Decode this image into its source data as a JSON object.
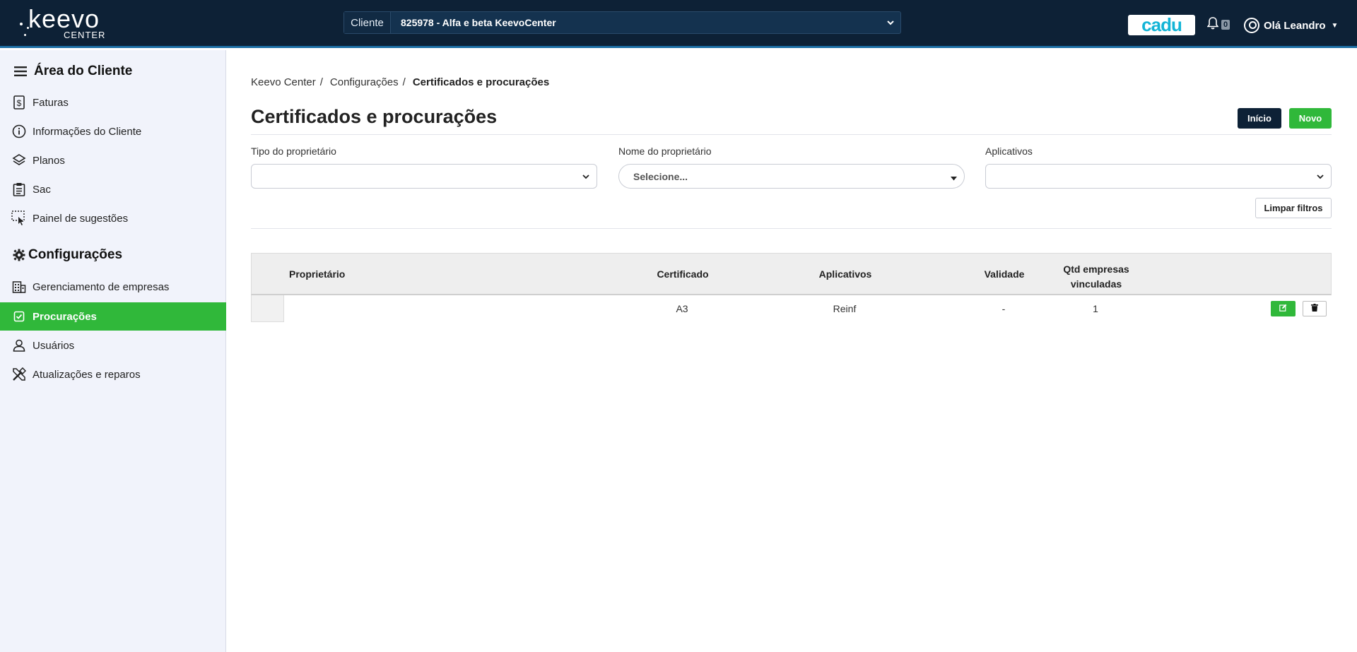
{
  "header": {
    "logo_text": "keevo",
    "logo_sub": "CENTER",
    "client_label": "Cliente",
    "client_value": "825978 - Alfa e beta KeevoCenter",
    "cadu_label": "cadu",
    "notification_count": "0",
    "user_greeting": "Olá Leandro"
  },
  "sidebar": {
    "section1_title": "Área do Cliente",
    "section1_items": [
      {
        "label": "Faturas",
        "icon": "invoice-icon"
      },
      {
        "label": "Informações do Cliente",
        "icon": "info-icon"
      },
      {
        "label": "Planos",
        "icon": "layers-icon"
      },
      {
        "label": "Sac",
        "icon": "clipboard-icon"
      },
      {
        "label": "Painel de sugestões",
        "icon": "pointer-icon"
      }
    ],
    "section2_title": "Configurações",
    "section2_items": [
      {
        "label": "Gerenciamento de empresas",
        "icon": "building-icon"
      },
      {
        "label": "Procurações",
        "icon": "check-square-icon",
        "active": true
      },
      {
        "label": "Usuários",
        "icon": "user-icon"
      },
      {
        "label": "Atualizações e reparos",
        "icon": "tools-icon"
      }
    ]
  },
  "breadcrumb": {
    "items": [
      "Keevo Center",
      "Configurações"
    ],
    "current": "Certificados e procurações"
  },
  "page": {
    "title": "Certificados e procurações",
    "btn_inicio": "Início",
    "btn_novo": "Novo"
  },
  "filters": {
    "tipo_label": "Tipo do proprietário",
    "tipo_value": "",
    "nome_label": "Nome do proprietário",
    "nome_value": "Selecione...",
    "aplicativos_label": "Aplicativos",
    "aplicativos_value": "",
    "limpar_label": "Limpar filtros"
  },
  "table": {
    "headers": {
      "proprietario": "Proprietário",
      "certificado": "Certificado",
      "aplicativos": "Aplicativos",
      "validade": "Validade",
      "qtd_line1": "Qtd empresas",
      "qtd_line2": "vinculadas"
    },
    "rows": [
      {
        "proprietario": "",
        "certificado": "A3",
        "aplicativos": "Reinf",
        "validade": "-",
        "qtd": "1"
      }
    ]
  },
  "colors": {
    "topbar": "#0d2136",
    "accent_green": "#30b83a",
    "sidebar_bg": "#f1f3fb",
    "cadu_text": "#13b4d6"
  }
}
